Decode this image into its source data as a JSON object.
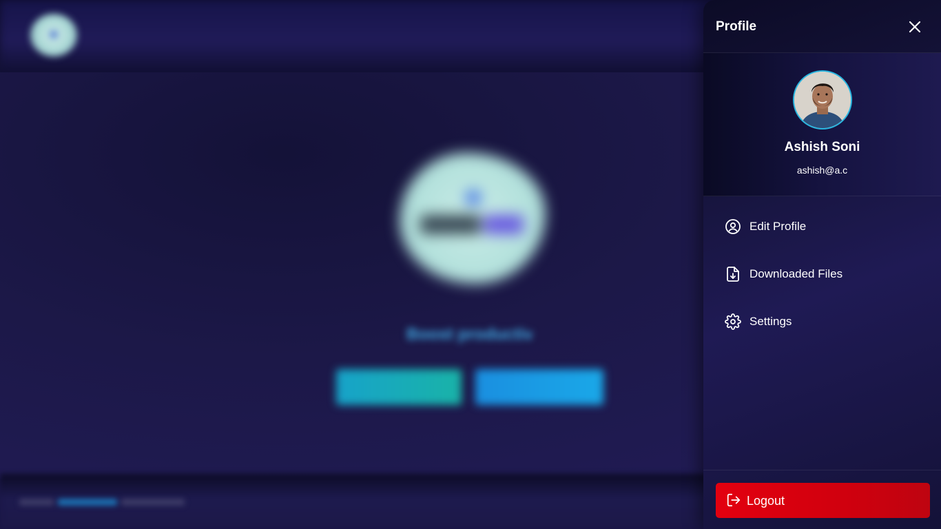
{
  "background_app": {
    "tagline": "Boost productivity",
    "button_colors": [
      "#17a3c9",
      "#1a8fe0"
    ]
  },
  "drawer": {
    "title": "Profile",
    "close_icon": "close-icon",
    "user": {
      "name": "Ashish Soni",
      "email": "ashish@a.c",
      "avatar_border_color": "#27b5e0"
    },
    "menu": [
      {
        "label": "Edit Profile",
        "icon": "user-circle-icon"
      },
      {
        "label": "Downloaded Files",
        "icon": "file-download-icon"
      },
      {
        "label": "Settings",
        "icon": "gear-icon"
      }
    ],
    "logout": {
      "label": "Logout",
      "icon": "logout-icon",
      "color": "#e3000f"
    }
  }
}
